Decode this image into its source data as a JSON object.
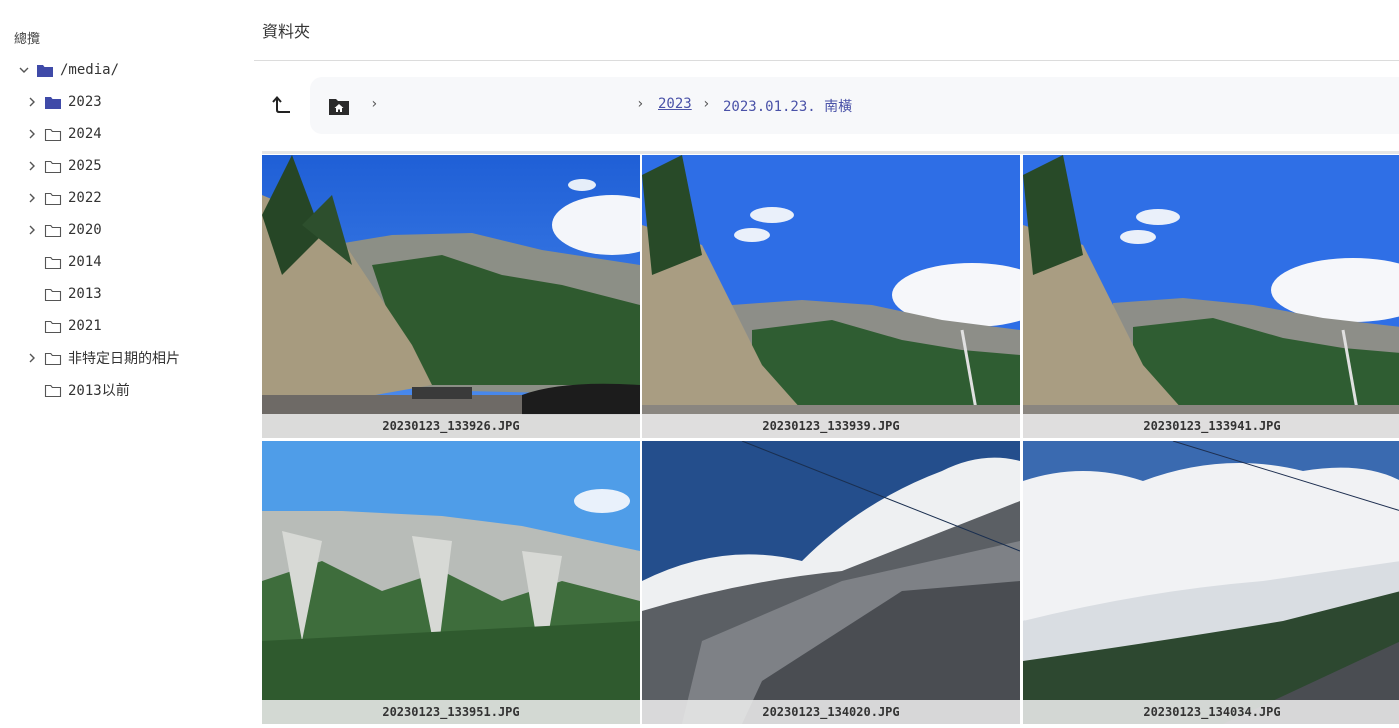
{
  "sidebar": {
    "title": "總攬",
    "tree": [
      {
        "label": "/media/",
        "expanded": true,
        "has_children": true,
        "active": true
      },
      {
        "label": "2023",
        "expanded": false,
        "has_children": true,
        "active": true
      },
      {
        "label": "2024",
        "expanded": false,
        "has_children": true,
        "active": false
      },
      {
        "label": "2025",
        "expanded": false,
        "has_children": true,
        "active": false
      },
      {
        "label": "2022",
        "expanded": false,
        "has_children": true,
        "active": false
      },
      {
        "label": "2020",
        "expanded": false,
        "has_children": true,
        "active": false
      },
      {
        "label": "2014",
        "expanded": false,
        "has_children": false,
        "active": false
      },
      {
        "label": "2013",
        "expanded": false,
        "has_children": false,
        "active": false
      },
      {
        "label": "2021",
        "expanded": false,
        "has_children": false,
        "active": false
      },
      {
        "label": "非特定日期的相片",
        "expanded": false,
        "has_children": true,
        "active": false
      },
      {
        "label": "2013以前",
        "expanded": false,
        "has_children": false,
        "active": false
      }
    ]
  },
  "header": {
    "title": "資料夾"
  },
  "breadcrumb": {
    "separator": "›",
    "link": "2023",
    "current": "2023.01.23. 南橫"
  },
  "photos": [
    {
      "filename": "20230123_133926.JPG"
    },
    {
      "filename": "20230123_133939.JPG"
    },
    {
      "filename": "20230123_133941.JPG"
    },
    {
      "filename": "20230123_133951.JPG"
    },
    {
      "filename": "20230123_134020.JPG"
    },
    {
      "filename": "20230123_134034.JPG"
    }
  ],
  "colors": {
    "accent": "#3f4aa8",
    "link": "#4a52a8",
    "folder_outline": "#555555"
  },
  "icons": {
    "up": "level-up-icon",
    "home": "home-folder-icon",
    "folder": "folder-icon",
    "chevron_right": "chevron-right-icon",
    "chevron_down": "chevron-down-icon"
  }
}
